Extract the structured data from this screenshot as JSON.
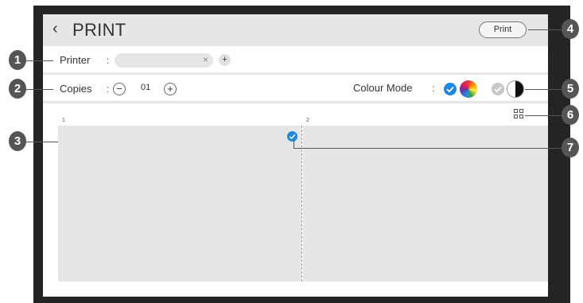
{
  "header": {
    "back_icon": "chevron-left-icon",
    "title": "PRINT",
    "print_button": "Print"
  },
  "printer_row": {
    "label": "Printer",
    "colon": ":",
    "clear_icon": "close-icon",
    "add_icon": "plus-icon"
  },
  "copies_row": {
    "label": "Copies",
    "colon": ":",
    "decrement": "−",
    "value": "01",
    "increment": "+"
  },
  "colour_mode": {
    "label": "Colour Mode",
    "colon": ":",
    "selected": "colour",
    "options": [
      "colour",
      "black-and-white"
    ]
  },
  "preview": {
    "layout_icon": "grid-view-icon",
    "pages": [
      "1",
      "2"
    ],
    "selected_page_icon": "check-circle-icon"
  },
  "callouts": [
    "1",
    "2",
    "3",
    "4",
    "5",
    "6",
    "7"
  ],
  "colors": {
    "accent": "#1e88e5",
    "header_bg": "#e6e6e6",
    "callout_bg": "#555555",
    "bezel": "#242424"
  }
}
